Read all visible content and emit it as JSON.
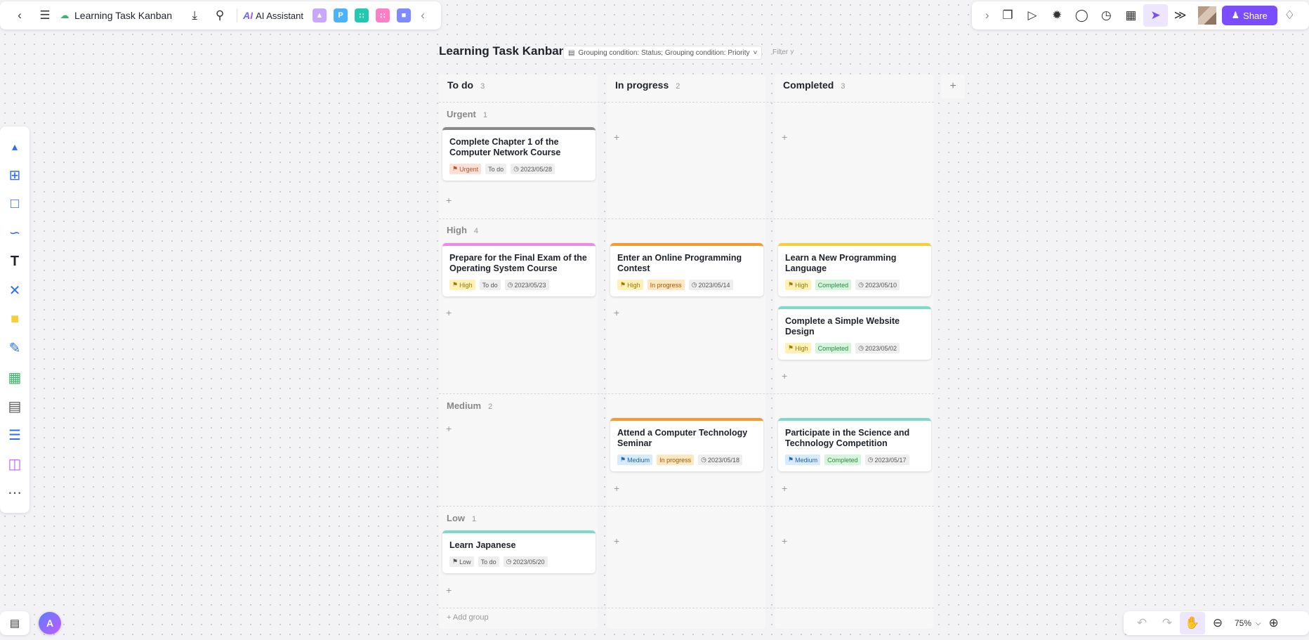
{
  "topbar": {
    "title": "Learning Task Kanban",
    "ai_label": "AI Assistant",
    "share_label": "Share"
  },
  "board": {
    "title": "Learning Task Kanban",
    "grouping": "Grouping condition: Status; Grouping condition: Priority",
    "filter": "Filter",
    "add_group": "+ Add group",
    "columns": [
      {
        "title": "To do",
        "count": "3"
      },
      {
        "title": "In progress",
        "count": "2"
      },
      {
        "title": "Completed",
        "count": "3"
      }
    ],
    "groups": [
      {
        "title": "Urgent",
        "count": "1"
      },
      {
        "title": "High",
        "count": "4"
      },
      {
        "title": "Medium",
        "count": "2"
      },
      {
        "title": "Low",
        "count": "1"
      }
    ],
    "cards": [
      {
        "title": "Complete Chapter 1 of the Computer Network Course",
        "priority": "Urgent",
        "status": "To do",
        "date": "2023/05/28"
      },
      {
        "title": "Prepare for the Final Exam of the Operating System Course",
        "priority": "High",
        "status": "To do",
        "date": "2023/05/23"
      },
      {
        "title": "Enter an Online Programming Contest",
        "priority": "High",
        "status": "In progress",
        "date": "2023/05/14"
      },
      {
        "title": "Learn a New Programming Language",
        "priority": "High",
        "status": "Completed",
        "date": "2023/05/10"
      },
      {
        "title": "Complete a Simple Website Design",
        "priority": "High",
        "status": "Completed",
        "date": "2023/05/02"
      },
      {
        "title": "Attend a Computer Technology Seminar",
        "priority": "Medium",
        "status": "In progress",
        "date": "2023/05/18"
      },
      {
        "title": "Participate in the Science and Technology Competition",
        "priority": "Medium",
        "status": "Completed",
        "date": "2023/05/17"
      },
      {
        "title": "Learn Japanese",
        "priority": "Low",
        "status": "To do",
        "date": "2023/05/20"
      }
    ]
  },
  "zoom": {
    "level": "75%"
  },
  "colors": {
    "accent": "#7a4dff",
    "urgent": "#8a8a8a",
    "high_pink": "#f08ae0",
    "orange": "#f59a2f",
    "yellow": "#f5cf3a",
    "teal": "#7fd9c8"
  }
}
